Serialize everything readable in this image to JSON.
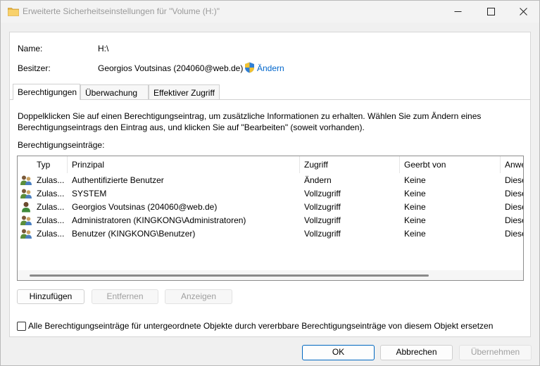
{
  "window": {
    "title": "Erweiterte Sicherheitseinstellungen für \"Volume (H:)\""
  },
  "info": {
    "name_label": "Name:",
    "name_value": "H:\\",
    "owner_label": "Besitzer:",
    "owner_value": "Georgios Voutsinas (204060@web.de)",
    "change_link": "Ändern"
  },
  "tabs": [
    {
      "label": "Berechtigungen",
      "active": true
    },
    {
      "label": "Überwachung",
      "active": false
    },
    {
      "label": "Effektiver Zugriff",
      "active": false
    }
  ],
  "description": "Doppelklicken Sie auf einen Berechtigungseintrag, um zusätzliche Informationen zu erhalten. Wählen Sie zum Ändern eines Berechtigungseintrags den Eintrag aus, und klicken Sie auf \"Bearbeiten\" (soweit vorhanden).",
  "entries_label": "Berechtigungseinträge:",
  "columns": [
    "Typ",
    "Prinzipal",
    "Zugriff",
    "Geerbt von",
    "Anwe"
  ],
  "rows": [
    {
      "icon": "group-icon",
      "type": "Zulas...",
      "principal": "Authentifizierte Benutzer",
      "access": "Ändern",
      "inherited": "Keine",
      "applies": "Diese"
    },
    {
      "icon": "group-icon",
      "type": "Zulas...",
      "principal": "SYSTEM",
      "access": "Vollzugriff",
      "inherited": "Keine",
      "applies": "Diese"
    },
    {
      "icon": "user-icon",
      "type": "Zulas...",
      "principal": "Georgios Voutsinas (204060@web.de)",
      "access": "Vollzugriff",
      "inherited": "Keine",
      "applies": "Diese"
    },
    {
      "icon": "group-icon",
      "type": "Zulas...",
      "principal": "Administratoren (KINGKONG\\Administratoren)",
      "access": "Vollzugriff",
      "inherited": "Keine",
      "applies": "Diese"
    },
    {
      "icon": "group-icon",
      "type": "Zulas...",
      "principal": "Benutzer (KINGKONG\\Benutzer)",
      "access": "Vollzugriff",
      "inherited": "Keine",
      "applies": "Diese"
    }
  ],
  "buttons": {
    "add": "Hinzufügen",
    "remove": "Entfernen",
    "view": "Anzeigen",
    "ok": "OK",
    "cancel": "Abbrechen",
    "apply": "Übernehmen"
  },
  "replace_checkbox": {
    "label": "Alle Berechtigungseinträge für untergeordnete Objekte durch vererbbare Berechtigungseinträge von diesem Objekt ersetzen",
    "checked": false
  }
}
